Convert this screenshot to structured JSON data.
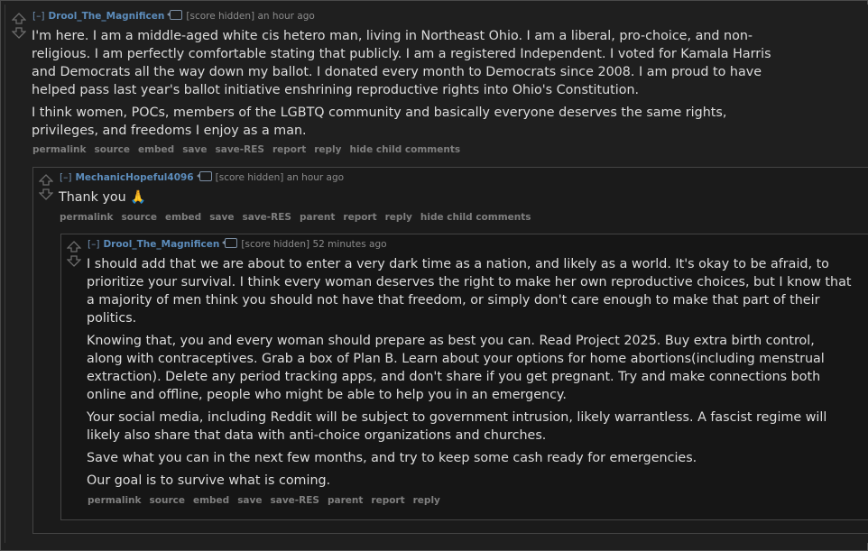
{
  "comments": [
    {
      "collapse": "[–]",
      "author": "Drool_The_Magnificen",
      "score": "[score hidden]",
      "time": "an hour ago",
      "paragraphs": [
        "I'm here. I am a middle-aged white cis hetero man, living in Northeast Ohio. I am a liberal, pro-choice, and non-religious. I am perfectly comfortable stating that publicly. I am a registered Independent. I voted for Kamala Harris and Democrats all the way down my ballot. I donated every month to Democrats since 2008. I am proud to have helped pass last year's ballot initiative enshrining reproductive rights into Ohio's Constitution.",
        "I think women, POCs, members of the LGBTQ community and basically everyone deserves the same rights, privileges, and freedoms I enjoy as a man."
      ],
      "buttons": [
        "permalink",
        "source",
        "embed",
        "save",
        "save-RES",
        "report",
        "reply",
        "hide child comments"
      ]
    },
    {
      "collapse": "[–]",
      "author": "MechanicHopeful4096",
      "score": "[score hidden]",
      "time": "an hour ago",
      "paragraphs": [
        "Thank you 🙏"
      ],
      "buttons": [
        "permalink",
        "source",
        "embed",
        "save",
        "save-RES",
        "parent",
        "report",
        "reply",
        "hide child comments"
      ]
    },
    {
      "collapse": "[–]",
      "author": "Drool_The_Magnificen",
      "score": "[score hidden]",
      "time": "52 minutes ago",
      "paragraphs": [
        "I should add that we are about to enter a very dark time as a nation, and likely as a world. It's okay to be afraid, to prioritize your survival. I think every woman deserves the right to make her own reproductive choices, but I know that a majority of men think you should not have that freedom, or simply don't care enough to make that part of their politics.",
        "Knowing that, you and every woman should prepare as best you can. Read Project 2025. Buy extra birth control, along with contraceptives. Grab a box of Plan B. Learn about your options for home abortions(including menstrual extraction). Delete any period tracking apps, and don't share if you get pregnant. Try and make connections both online and offline, people who might be able to help you in an emergency.",
        "Your social media, including Reddit will be subject to government intrusion, likely warrantless. A fascist regime will likely also share that data with anti-choice organizations and churches.",
        "Save what you can in the next few months, and try to keep some cash ready for emergencies.",
        "Our goal is to survive what is coming."
      ],
      "buttons": [
        "permalink",
        "source",
        "embed",
        "save",
        "save-RES",
        "parent",
        "report",
        "reply"
      ]
    }
  ]
}
